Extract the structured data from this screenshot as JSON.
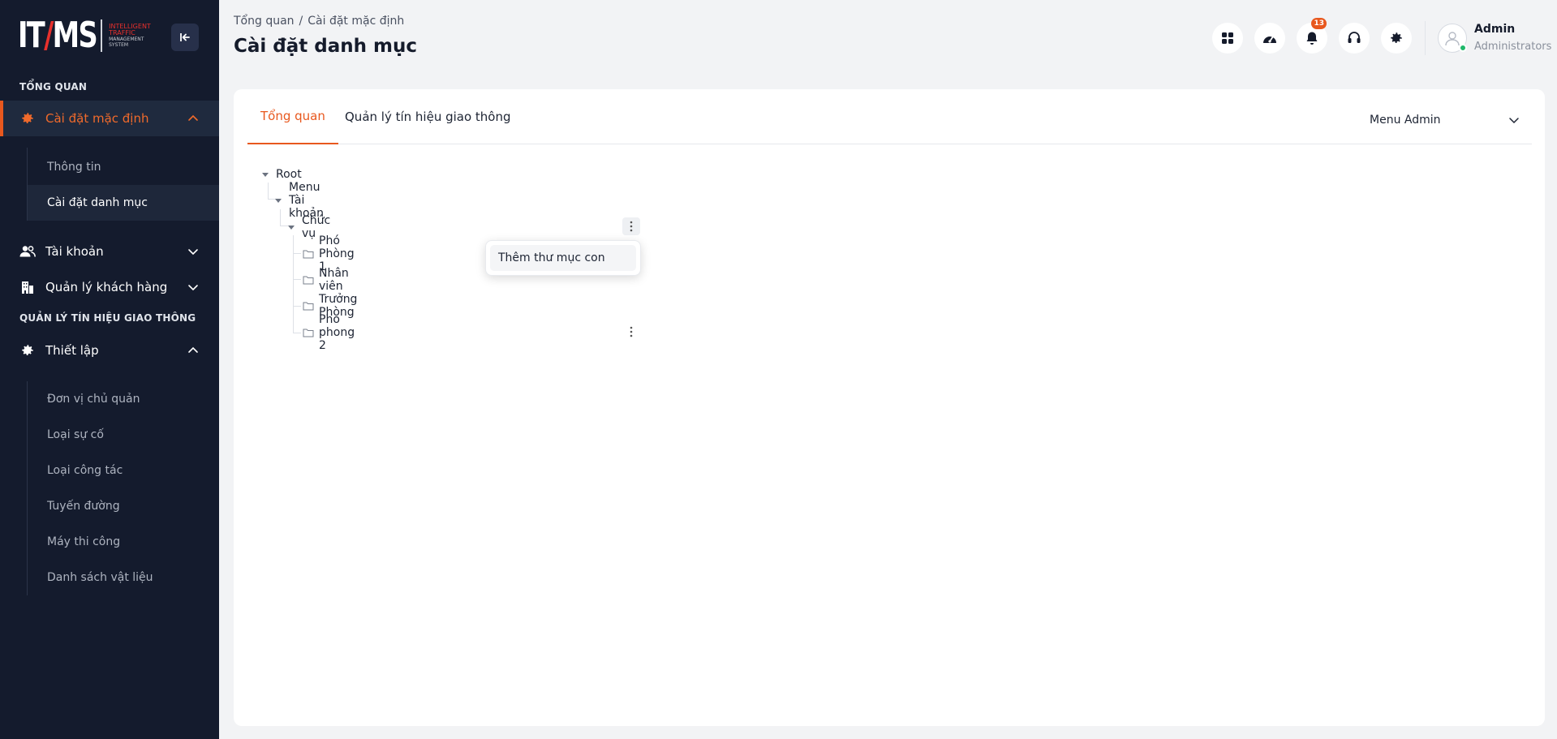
{
  "brand": {
    "logo_text": "ITMS",
    "tagline_1": "INTELLIGENT",
    "tagline_2": "TRAFFIC",
    "tagline_3": "MANAGEMENT",
    "tagline_4": "SYSTEM",
    "accent_color": "#e8581e"
  },
  "sidebar": {
    "section_overview": "TỔNG QUAN",
    "section_traffic": "QUẢN LÝ TÍN HIỆU GIAO THÔNG",
    "items": [
      {
        "label": "Cài đặt mặc định",
        "icon": "gear-icon",
        "expanded": true,
        "active": true
      },
      {
        "label": "Tài khoản",
        "icon": "users-icon",
        "expanded": false
      },
      {
        "label": "Quản lý khách hàng",
        "icon": "building-icon",
        "expanded": false
      },
      {
        "label": "Thiết lập",
        "icon": "gear-icon",
        "expanded": true
      }
    ],
    "default_settings_sub": [
      {
        "label": "Thông tin"
      },
      {
        "label": "Cài đặt danh mục",
        "active": true
      }
    ],
    "setup_sub": [
      {
        "label": "Đơn vị chủ quản"
      },
      {
        "label": "Loại sự cố"
      },
      {
        "label": "Loại công tác"
      },
      {
        "label": "Tuyến đường"
      },
      {
        "label": "Máy thi công"
      },
      {
        "label": "Danh sách vật liệu"
      }
    ]
  },
  "header": {
    "breadcrumb_home": "Tổng quan",
    "breadcrumb_sep": "/",
    "breadcrumb_current": "Cài đặt mặc định",
    "title": "Cài đặt danh mục",
    "notification_count": "13",
    "user_name": "Admin",
    "user_role": "Administrators"
  },
  "tabs": [
    {
      "label": "Tổng quan",
      "active": true
    },
    {
      "label": "Quản lý tín hiệu giao thông"
    }
  ],
  "menu_select": {
    "value": "Menu Admin"
  },
  "tree": {
    "root": "Root",
    "level1": "Menu Tài khoản",
    "level2": "Chức vụ",
    "leaves": [
      "Phó Phòng 1",
      "Nhân viên",
      "Trưởng Phòng",
      "Pho phong 2"
    ]
  },
  "context_menu": {
    "item": "Thêm thư mục con"
  }
}
